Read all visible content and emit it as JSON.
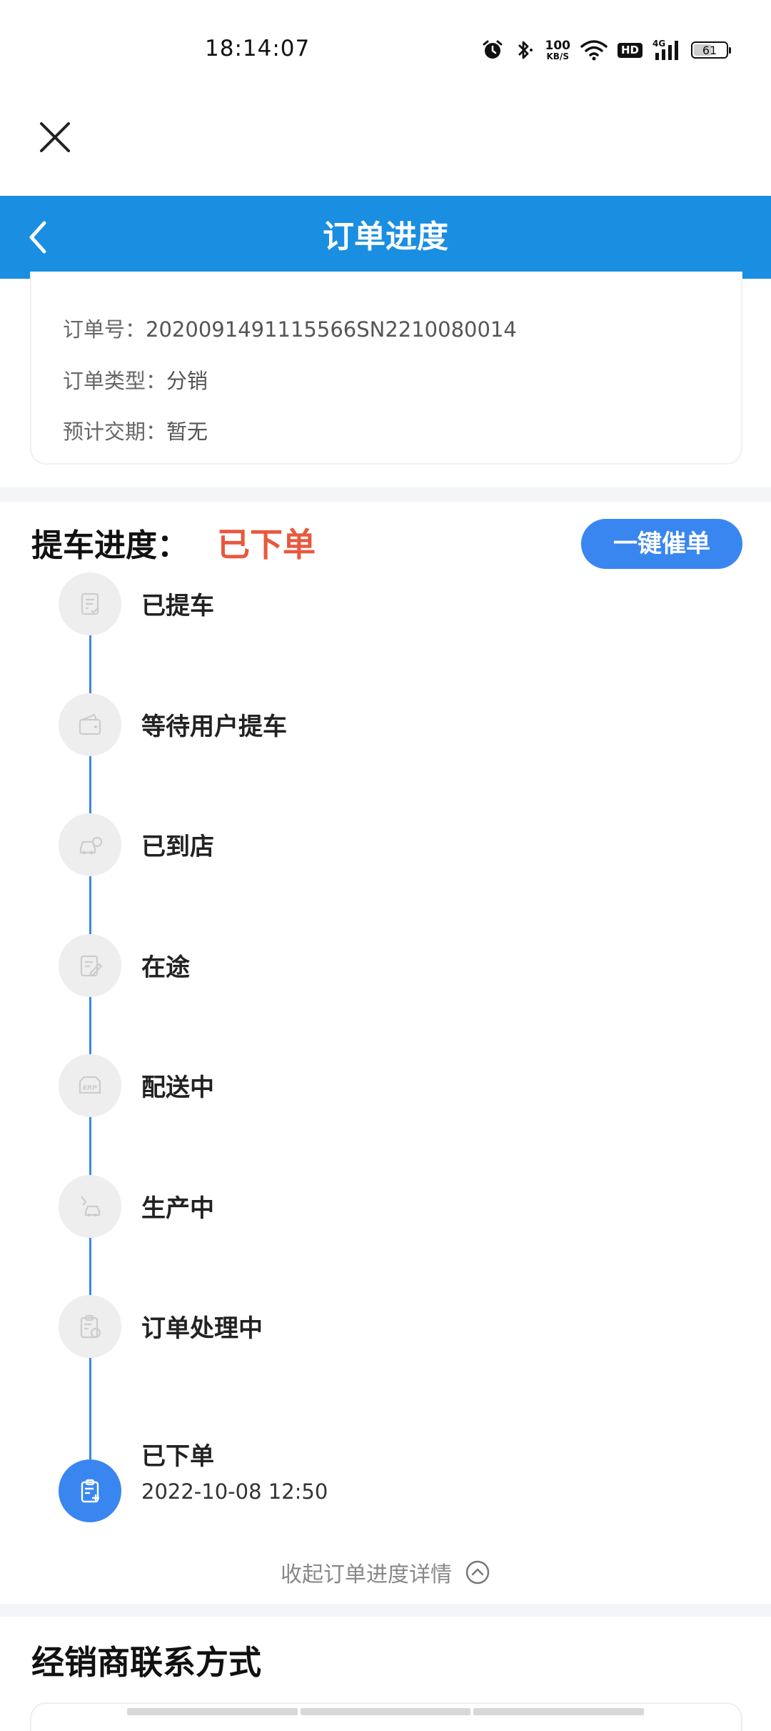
{
  "status_bar": {
    "time": "18:14:07",
    "net_speed_value": "100",
    "net_speed_unit": "KB/S",
    "hd_label": "HD",
    "signal_label": "4G",
    "battery_level": "61",
    "icons": [
      "alarm-icon",
      "bluetooth-icon",
      "wifi-icon",
      "signal-icon",
      "battery-icon"
    ]
  },
  "header": {
    "title": "订单进度"
  },
  "order_info": {
    "order_no_label": "订单号：",
    "order_no_value": "2020091491115566SN2210080014",
    "type_label": "订单类型：",
    "type_value": "分销",
    "delivery_label": "预计交期：",
    "delivery_value": "暂无"
  },
  "progress": {
    "label": "提车进度：",
    "current_status": "已下单",
    "urge_button": "一键催单",
    "steps": [
      {
        "label": "已提车",
        "icon": "document-check-icon",
        "active": false,
        "time": ""
      },
      {
        "label": "等待用户提车",
        "icon": "wallet-icon",
        "active": false,
        "time": ""
      },
      {
        "label": "已到店",
        "icon": "car-store-icon",
        "active": false,
        "time": ""
      },
      {
        "label": "在途",
        "icon": "edit-document-icon",
        "active": false,
        "time": ""
      },
      {
        "label": "配送中",
        "icon": "erp-truck-icon",
        "active": false,
        "time": ""
      },
      {
        "label": "生产中",
        "icon": "factory-car-icon",
        "active": false,
        "time": ""
      },
      {
        "label": "订单处理中",
        "icon": "clipboard-clock-icon",
        "active": false,
        "time": ""
      },
      {
        "label": "已下单",
        "icon": "clipboard-plus-icon",
        "active": true,
        "time": "2022-10-08 12:50"
      }
    ],
    "collapse_label": "收起订单进度详情"
  },
  "dealer": {
    "title": "经销商联系方式"
  },
  "colors": {
    "header_blue": "#1a8ee1",
    "accent_blue": "#3a86f0",
    "status_red": "#e8583e",
    "inactive_circle": "#eeeeee"
  }
}
